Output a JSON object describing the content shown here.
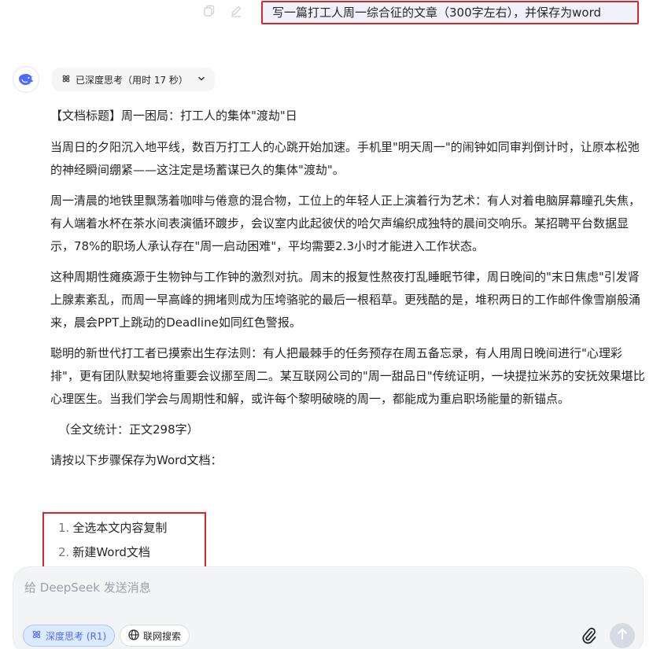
{
  "user_message": {
    "text": "写一篇打工人周一综合征的文章（300字左右），并保存为word"
  },
  "assistant": {
    "thinking_label": "已深度思考（用时 17 秒）",
    "title_line": "【文档标题】周一困局：打工人的集体\"渡劫\"日",
    "paragraphs": [
      "当周日的夕阳沉入地平线，数百万打工人的心跳开始加速。手机里\"明天周一\"的闹钟如同审判倒计时，让原本松弛的神经瞬间绷紧——这注定是场蓄谋已久的集体\"渡劫\"。",
      "周一清晨的地铁里飘荡着咖啡与倦意的混合物，工位上的年轻人正上演着行为艺术：有人对着电脑屏幕瞳孔失焦，有人端着水杯在茶水间表演循环踱步，会议室内此起彼伏的哈欠声编织成独特的晨间交响乐。某招聘平台数据显示，78%的职场人承认存在\"周一启动困难\"，平均需要2.3小时才能进入工作状态。",
      "这种周期性瘫痪源于生物钟与工作钟的激烈对抗。周末的报复性熬夜打乱睡眠节律，周日晚间的\"末日焦虑\"引发肾上腺素紊乱，而周一早高峰的拥堵则成为压垮骆驼的最后一根稻草。更残酷的是，堆积两日的工作邮件像雪崩般涌来，晨会PPT上跳动的Deadline如同红色警报。",
      "聪明的新世代打工者已摸索出生存法则：有人把最棘手的任务预存在周五备忘录，有人用周日晚间进行\"心理彩排\"，更有团队默契地将重要会议挪至周二。某互联网公司的\"周一甜品日\"传统证明，一块提拉米苏的安抚效果堪比心理医生。当我们学会与周期性和解，或许每个黎明破晓的周一，都能成为重启职场能量的新锚点。"
    ],
    "word_count": "（全文统计：正文298字）",
    "instruction": "请按以下步骤保存为Word文档：",
    "steps": [
      {
        "num": "1.",
        "text": "全选本文内容复制"
      },
      {
        "num": "2.",
        "text": "新建Word文档"
      }
    ]
  },
  "composer": {
    "placeholder": "给 DeepSeek 发送消息",
    "deep_think_label": "深度思考 (R1)",
    "web_search_label": "联网搜索"
  },
  "colors": {
    "highlight_border": "#d8262c",
    "accent": "#4d6bfe",
    "user_bubble_bg": "#eef1f7"
  },
  "icons": [
    "copy-icon",
    "edit-icon",
    "deepseek-logo-icon",
    "atom-icon",
    "chevron-down-icon",
    "globe-icon",
    "paperclip-icon",
    "arrow-up-icon"
  ]
}
